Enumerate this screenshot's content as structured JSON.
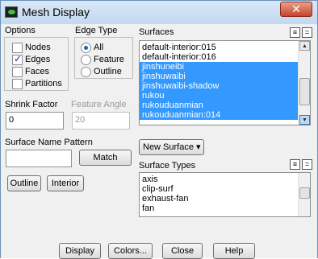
{
  "window": {
    "title": "Mesh Display",
    "close_glyph": "✕"
  },
  "options": {
    "header": "Options",
    "items": [
      {
        "label": "Nodes",
        "checked": false
      },
      {
        "label": "Edges",
        "checked": true
      },
      {
        "label": "Faces",
        "checked": false
      },
      {
        "label": "Partitions",
        "checked": false
      }
    ]
  },
  "edge_type": {
    "header": "Edge Type",
    "items": [
      {
        "label": "All",
        "selected": true
      },
      {
        "label": "Feature",
        "selected": false
      },
      {
        "label": "Outline",
        "selected": false
      }
    ]
  },
  "surfaces": {
    "header": "Surfaces",
    "items": [
      {
        "label": "default-interior:015",
        "selected": false
      },
      {
        "label": "default-interior:016",
        "selected": false
      },
      {
        "label": "jinshuneibi",
        "selected": true
      },
      {
        "label": "jinshuwaibi",
        "selected": true
      },
      {
        "label": "jinshuwaibi-shadow",
        "selected": true
      },
      {
        "label": "rukou",
        "selected": true
      },
      {
        "label": "rukouduanmian",
        "selected": true
      },
      {
        "label": "rukouduanmian:014",
        "selected": true
      }
    ]
  },
  "shrink_factor": {
    "label": "Shrink Factor",
    "value": "0"
  },
  "feature_angle": {
    "label": "Feature Angle",
    "value": "20"
  },
  "surface_name_pattern": {
    "label": "Surface Name Pattern",
    "value": "",
    "match_label": "Match"
  },
  "buttons": {
    "outline": "Outline",
    "interior": "Interior"
  },
  "new_surface": {
    "label": "New Surface",
    "arrow": "▾"
  },
  "surface_types": {
    "header": "Surface Types",
    "items": [
      "axis",
      "clip-surf",
      "exhaust-fan",
      "fan"
    ]
  },
  "footer": {
    "display": "Display",
    "colors": "Colors...",
    "close": "Close",
    "help": "Help"
  },
  "icons": {
    "select_all": "≡",
    "deselect_all": "="
  }
}
